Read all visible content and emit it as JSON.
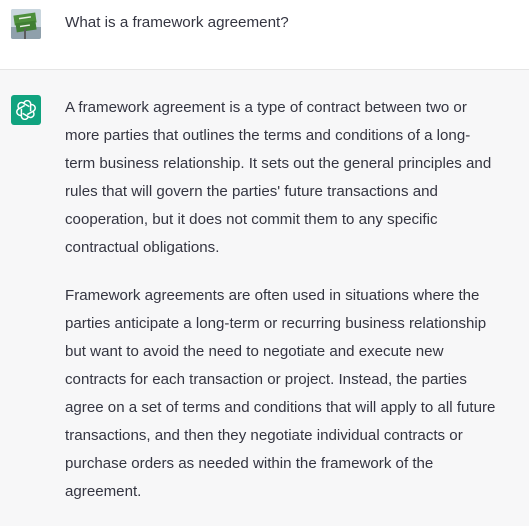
{
  "user_message": {
    "avatar_icon": "user-avatar-photo-icon",
    "text": "What is a framework agreement?"
  },
  "assistant_message": {
    "avatar_icon": "openai-logo-icon",
    "accent_color": "#10a37f",
    "paragraphs": [
      {
        "lines": [
          "A framework agreement is a type of contract between two or",
          "more parties that outlines the terms and conditions of a long-",
          "term business relationship. It sets out the general principles and",
          "rules that will govern the parties' future transactions and",
          "cooperation, but it does not commit them to any specific",
          "contractual obligations."
        ]
      },
      {
        "lines": [
          "Framework agreements are often used in situations where the",
          "parties anticipate a long-term or recurring business relationship",
          "but want to avoid the need to negotiate and execute new",
          "contracts for each transaction or project. Instead, the parties",
          "agree on a set of terms and conditions that will apply to all future",
          "transactions, and then they negotiate individual contracts or",
          "purchase orders as needed within the framework of the",
          "agreement."
        ]
      }
    ]
  }
}
